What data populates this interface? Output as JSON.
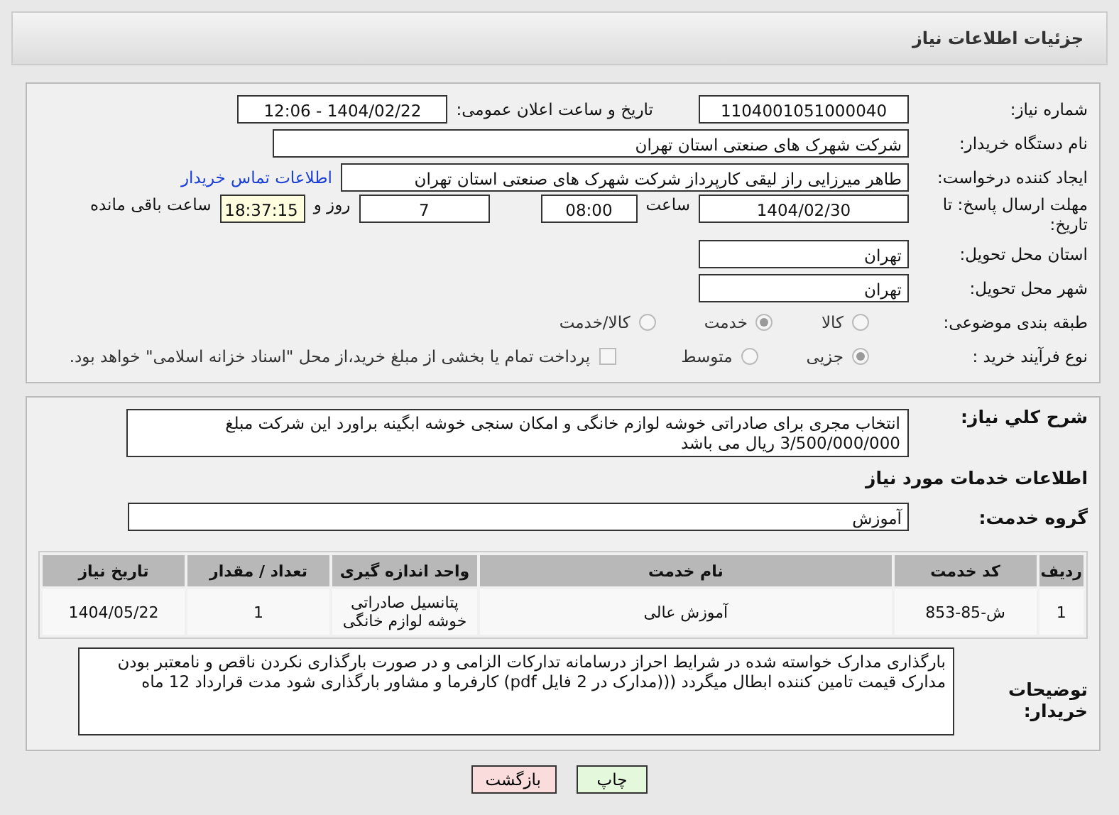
{
  "header": {
    "title": "جزئیات اطلاعات نیاز"
  },
  "need_number": {
    "label": "شماره نیاز:",
    "value": "1104001051000040"
  },
  "announce": {
    "label": "تاریخ و ساعت اعلان عمومی:",
    "value": "1404/02/22 - 12:06"
  },
  "buyer_org": {
    "label": "نام دستگاه خریدار:",
    "value": "شرکت شهرک های صنعتی استان تهران"
  },
  "requester": {
    "label": "ایجاد کننده درخواست:",
    "value": "طاهر  میرزایی راز لیقی کارپرداز شرکت شهرک های صنعتی استان تهران",
    "link": "اطلاعات تماس خریدار"
  },
  "deadline": {
    "label": "مهلت ارسال پاسخ: تا تاریخ:",
    "date": "1404/02/30",
    "time_label": "ساعت",
    "time": "08:00",
    "days": "7",
    "days_label": "روز و",
    "remaining": "18:37:15",
    "remaining_label": "ساعت باقی مانده"
  },
  "province": {
    "label": "استان محل تحویل:",
    "value": "تهران"
  },
  "city": {
    "label": "شهر محل تحویل:",
    "value": "تهران"
  },
  "category": {
    "label": "طبقه بندی موضوعی:",
    "options": [
      {
        "label": "کالا",
        "selected": false
      },
      {
        "label": "خدمت",
        "selected": true
      },
      {
        "label": "کالا/خدمت",
        "selected": false
      }
    ]
  },
  "process": {
    "label": "نوع فرآیند خرید :",
    "options": [
      {
        "label": "جزیی",
        "selected": true
      },
      {
        "label": "متوسط",
        "selected": false
      }
    ],
    "payment": {
      "checked": false,
      "label": "پرداخت تمام یا بخشی از مبلغ خرید،از محل \"اسناد خزانه اسلامی\" خواهد بود."
    }
  },
  "summary": {
    "label": "شرح کلي نياز:",
    "value": "انتخاب مجری برای صادراتی خوشه لوازم خانگی و امکان سنجی خوشه ابگینه براورد این شرکت مبلغ 3/500/000/000 ریال می باشد"
  },
  "services_title": "اطلاعات خدمات مورد نیاز",
  "service_group": {
    "label": "گروه خدمت:",
    "value": "آموزش"
  },
  "table": {
    "columns": [
      "ردیف",
      "کد خدمت",
      "نام خدمت",
      "واحد اندازه گیری",
      "تعداد / مقدار",
      "تاریخ نیاز"
    ],
    "rows": [
      [
        "1",
        "ش-85-853",
        "آموزش عالی",
        "پتانسیل صادراتی خوشه لوازم خانگی",
        "1",
        "1404/05/22"
      ]
    ]
  },
  "buyer_notes": {
    "label": "توضیحات خریدار:",
    "value": "بارگذاری مدارک خواسته شده در شرایط احراز درسامانه  تدارکات الزامی و در صورت بارگذاری نکردن ناقص و نامعتبر بودن مدارک قیمت تامین کننده ابطال میگردد (((مدارک در 2 فایل pdf)   کارفرما  و مشاور  بارگذاری شود  مدت قرارداد 12 ماه"
  },
  "buttons": [
    {
      "label": "چاپ",
      "kind": "print"
    },
    {
      "label": "بازگشت",
      "kind": "back"
    }
  ]
}
